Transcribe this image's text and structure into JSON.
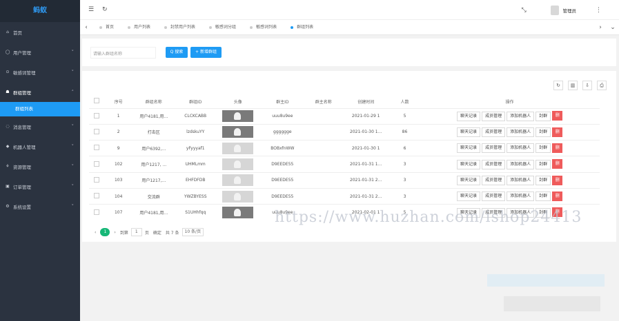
{
  "sidebar": {
    "logo": "蚂蚁",
    "items": [
      {
        "label": "首页",
        "icon": "home-icon",
        "glyph": "⌂",
        "arrow": false
      },
      {
        "label": "用户管理",
        "icon": "user-icon",
        "glyph": "◯",
        "arrow": true
      },
      {
        "label": "敏感词管理",
        "icon": "shield-icon",
        "glyph": "⊙",
        "arrow": true
      },
      {
        "label": "群组管理",
        "icon": "group-icon",
        "glyph": "☗",
        "arrow": true,
        "open": true
      },
      {
        "label": "消息管理",
        "icon": "message-icon",
        "glyph": "◌",
        "arrow": true
      },
      {
        "label": "机器人管理",
        "icon": "robot-icon",
        "glyph": "◆",
        "arrow": true
      },
      {
        "label": "资源管理",
        "icon": "resource-icon",
        "glyph": "⚘",
        "arrow": true
      },
      {
        "label": "订单管理",
        "icon": "order-icon",
        "glyph": "▣",
        "arrow": true
      },
      {
        "label": "系统设置",
        "icon": "settings-icon",
        "glyph": "⚙",
        "arrow": true
      }
    ],
    "sub_item": "群组列表"
  },
  "topbar": {
    "username": "管理员"
  },
  "tabs": [
    "首页",
    "用户列表",
    "封禁用户列表",
    "敏感词分组",
    "敏感词列表",
    "群组列表"
  ],
  "search": {
    "placeholder": "请输入群组名称",
    "search_label": "Q 搜索",
    "add_label": "+ 新增群组"
  },
  "table": {
    "headers": [
      "序号",
      "群组名称",
      "群组ID",
      "头像",
      "群主ID",
      "群主名称",
      "创建时间",
      "人数",
      "操作"
    ],
    "rows": [
      {
        "seq": "1",
        "name": "用户4181,用...",
        "gid": "CLCKCABB",
        "owner": "uuu8u9ee",
        "owner_name": "",
        "created": "2021-01-29 1",
        "count": "5",
        "avatar": "photo"
      },
      {
        "seq": "2",
        "name": "打击区",
        "gid": "lzdskuYY",
        "owner": "gggggge",
        "owner_name": "",
        "created": "2021-01-30 1...",
        "count": "86",
        "avatar": "photo"
      },
      {
        "seq": "9",
        "name": "用户6392,...",
        "gid": "yFyyyaf1",
        "owner": "BOBxfnWW",
        "owner_name": "",
        "created": "2021-01-30 1",
        "count": "6",
        "avatar": "default"
      },
      {
        "seq": "102",
        "name": "用户1217, ...",
        "gid": "UHMLmm",
        "owner": "D9EEDE55",
        "owner_name": "",
        "created": "2021-01-31 1...",
        "count": "3",
        "avatar": "default"
      },
      {
        "seq": "103",
        "name": "用户1217,...",
        "gid": "EHFDFDB",
        "owner": "D9EEDE55",
        "owner_name": "",
        "created": "2021-01-31 2...",
        "count": "3",
        "avatar": "default"
      },
      {
        "seq": "104",
        "name": "交流群",
        "gid": "YWZBYESS",
        "owner": "D9EEDE55",
        "owner_name": "",
        "created": "2021-01-31 2...",
        "count": "3",
        "avatar": "default"
      },
      {
        "seq": "107",
        "name": "用户4181,用...",
        "gid": "S1UHhfqq",
        "owner": "uuu8u9ee",
        "owner_name": "",
        "created": "2021-02-01 1",
        "count": "5",
        "avatar": "photo"
      }
    ],
    "actions": {
      "chat": "聊天记录",
      "members": "成员管理",
      "robot": "添加机器人",
      "ban": "封群",
      "delete": "删"
    }
  },
  "pager": {
    "current": "1",
    "goto_label": "到第",
    "page_value": "1",
    "page_unit": "页",
    "confirm": "确定",
    "total": "共 7 条",
    "limit": "10 条/页"
  },
  "watermark": "https://www.huzhan.com/ishop24413"
}
